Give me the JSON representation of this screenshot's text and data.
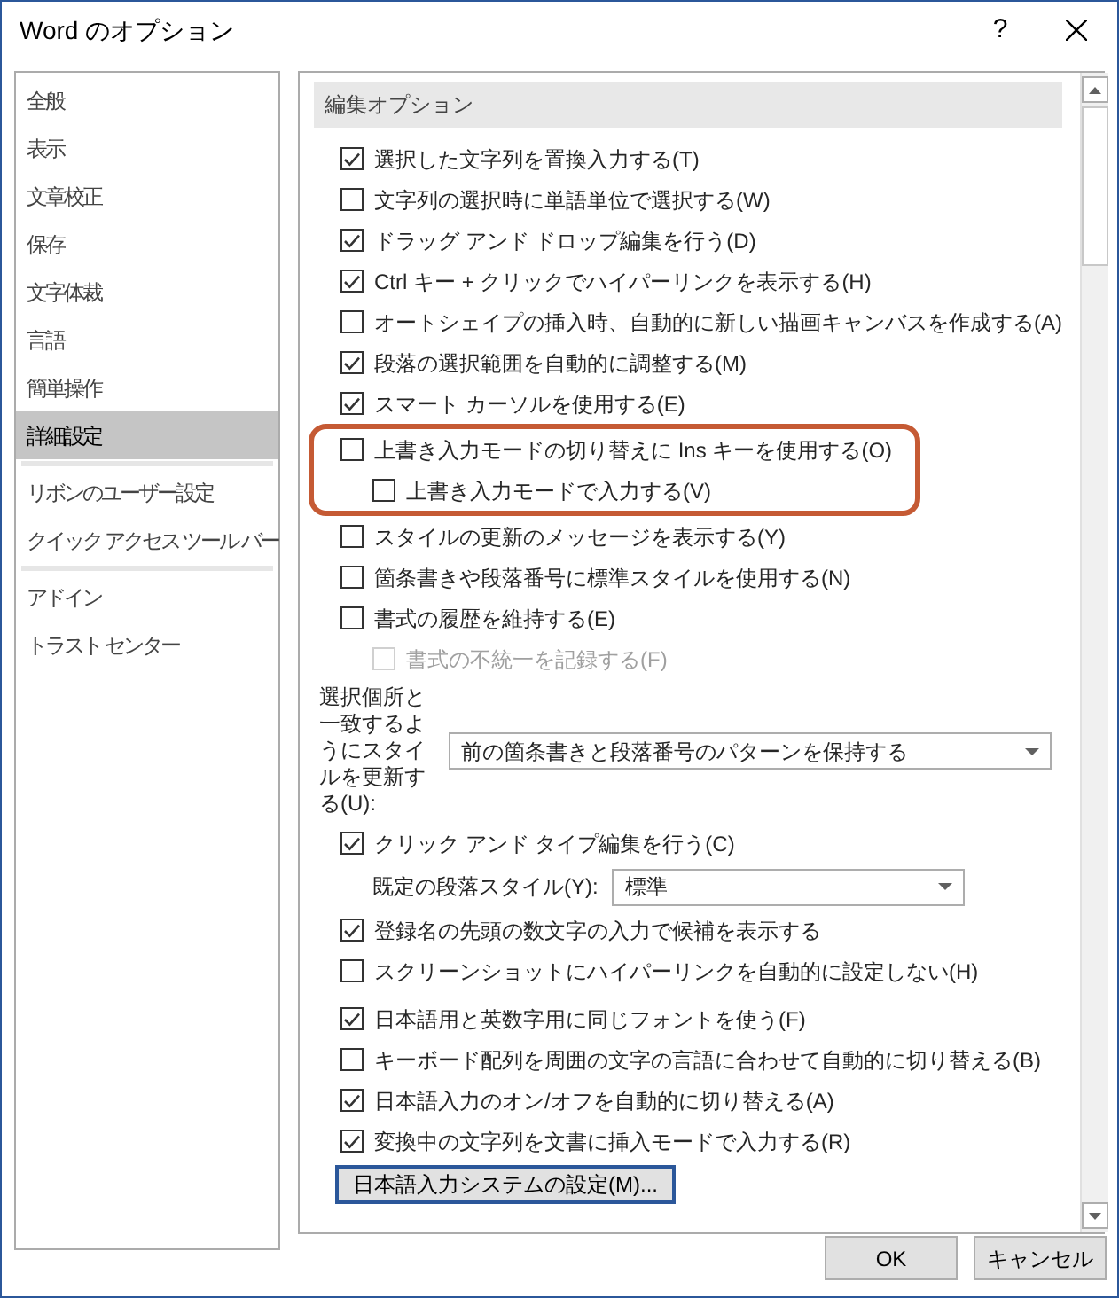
{
  "window": {
    "title": "Word のオプション",
    "help": "?"
  },
  "sidebar": {
    "groups": [
      {
        "items": [
          {
            "label": "全般",
            "selected": false
          },
          {
            "label": "表示",
            "selected": false
          },
          {
            "label": "文章校正",
            "selected": false
          },
          {
            "label": "保存",
            "selected": false
          },
          {
            "label": "文字体裁",
            "selected": false
          },
          {
            "label": "言語",
            "selected": false
          },
          {
            "label": "簡単操作",
            "selected": false
          },
          {
            "label": "詳細設定",
            "selected": true
          }
        ]
      },
      {
        "items": [
          {
            "label": "リボンのユーザー設定",
            "selected": false
          },
          {
            "label": "クイック アクセス ツール バー",
            "selected": false
          }
        ]
      },
      {
        "items": [
          {
            "label": "アドイン",
            "selected": false
          },
          {
            "label": "トラスト センター",
            "selected": false
          }
        ]
      }
    ]
  },
  "content": {
    "section_title": "編集オプション",
    "items": [
      {
        "kind": "checkbox",
        "label": "選択した文字列を置換入力する(T)",
        "checked": true,
        "disabled": false
      },
      {
        "kind": "checkbox",
        "label": "文字列の選択時に単語単位で選択する(W)",
        "checked": false,
        "disabled": false
      },
      {
        "kind": "checkbox",
        "label": "ドラッグ アンド ドロップ編集を行う(D)",
        "checked": true,
        "disabled": false
      },
      {
        "kind": "checkbox",
        "label": "Ctrl キー + クリックでハイパーリンクを表示する(H)",
        "checked": true,
        "disabled": false
      },
      {
        "kind": "checkbox",
        "label": "オートシェイプの挿入時、自動的に新しい描画キャンバスを作成する(A)",
        "checked": false,
        "disabled": false
      },
      {
        "kind": "checkbox",
        "label": "段落の選択範囲を自動的に調整する(M)",
        "checked": true,
        "disabled": false
      },
      {
        "kind": "checkbox",
        "label": "スマート カーソルを使用する(E)",
        "checked": true,
        "disabled": false
      },
      {
        "kind": "highlight",
        "items": [
          {
            "kind": "checkbox",
            "label": "上書き入力モードの切り替えに Ins キーを使用する(O)",
            "checked": false,
            "disabled": false,
            "children": [
              {
                "kind": "checkbox",
                "label": "上書き入力モードで入力する(V)",
                "checked": false,
                "disabled": false
              }
            ]
          }
        ]
      },
      {
        "kind": "checkbox",
        "label": "スタイルの更新のメッセージを表示する(Y)",
        "checked": false,
        "disabled": false
      },
      {
        "kind": "checkbox",
        "label": "箇条書きや段落番号に標準スタイルを使用する(N)",
        "checked": false,
        "disabled": false
      },
      {
        "kind": "checkbox",
        "label": "書式の履歴を維持する(E)",
        "checked": false,
        "disabled": false,
        "children": [
          {
            "kind": "checkbox",
            "label": "書式の不統一を記録する(F)",
            "checked": false,
            "disabled": true
          }
        ]
      },
      {
        "kind": "wrapped_dropdown",
        "label": "選択個所と一致するようにスタイルを更新する(U):",
        "value": "前の箇条書きと段落番号のパターンを保持する"
      },
      {
        "kind": "checkbox",
        "label": "クリック アンド タイプ編集を行う(C)",
        "checked": true,
        "disabled": false,
        "children": [
          {
            "kind": "dropdown",
            "label": "既定の段落スタイル(Y):",
            "value": "標準"
          }
        ]
      },
      {
        "kind": "checkbox",
        "label": "登録名の先頭の数文字の入力で候補を表示する",
        "checked": true,
        "disabled": false
      },
      {
        "kind": "checkbox",
        "label": "スクリーンショットにハイパーリンクを自動的に設定しない(H)",
        "checked": false,
        "disabled": false
      },
      {
        "kind": "gap"
      },
      {
        "kind": "checkbox",
        "label": "日本語用と英数字用に同じフォントを使う(F)",
        "checked": true,
        "disabled": false
      },
      {
        "kind": "checkbox",
        "label": "キーボード配列を周囲の文字の言語に合わせて自動的に切り替える(B)",
        "checked": false,
        "disabled": false
      },
      {
        "kind": "checkbox",
        "label": "日本語入力のオン/オフを自動的に切り替える(A)",
        "checked": true,
        "disabled": false
      },
      {
        "kind": "checkbox",
        "label": "変換中の文字列を文書に挿入モードで入力する(R)",
        "checked": true,
        "disabled": false
      },
      {
        "kind": "button",
        "label": "日本語入力システムの設定(M)..."
      }
    ]
  },
  "buttons": [
    "OK",
    "キャンセル"
  ]
}
